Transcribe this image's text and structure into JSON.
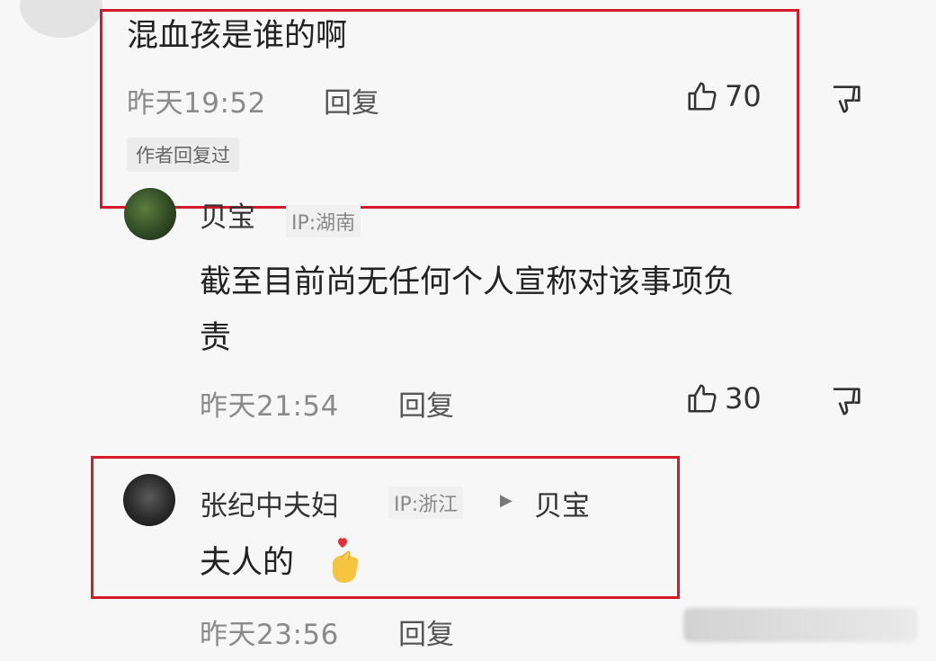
{
  "comment1": {
    "text": "混血孩是谁的啊",
    "time": "昨天19:52",
    "reply_label": "回复",
    "likes": "70",
    "author_tag": "作者回复过"
  },
  "reply1": {
    "username": "贝宝",
    "ip": "IP:湖南",
    "text_line1": "截至目前尚无任何个人宣称对该事项负",
    "text_line2": "责",
    "time": "昨天21:54",
    "reply_label": "回复",
    "likes": "30"
  },
  "reply2": {
    "username": "张纪中夫妇",
    "ip": "IP:浙江",
    "reply_to": "贝宝",
    "text": "夫人的",
    "time": "昨天23:56",
    "reply_label": "回复"
  },
  "colors": {
    "highlight_border": "#d11a2a",
    "background": "#f7f7f7"
  }
}
